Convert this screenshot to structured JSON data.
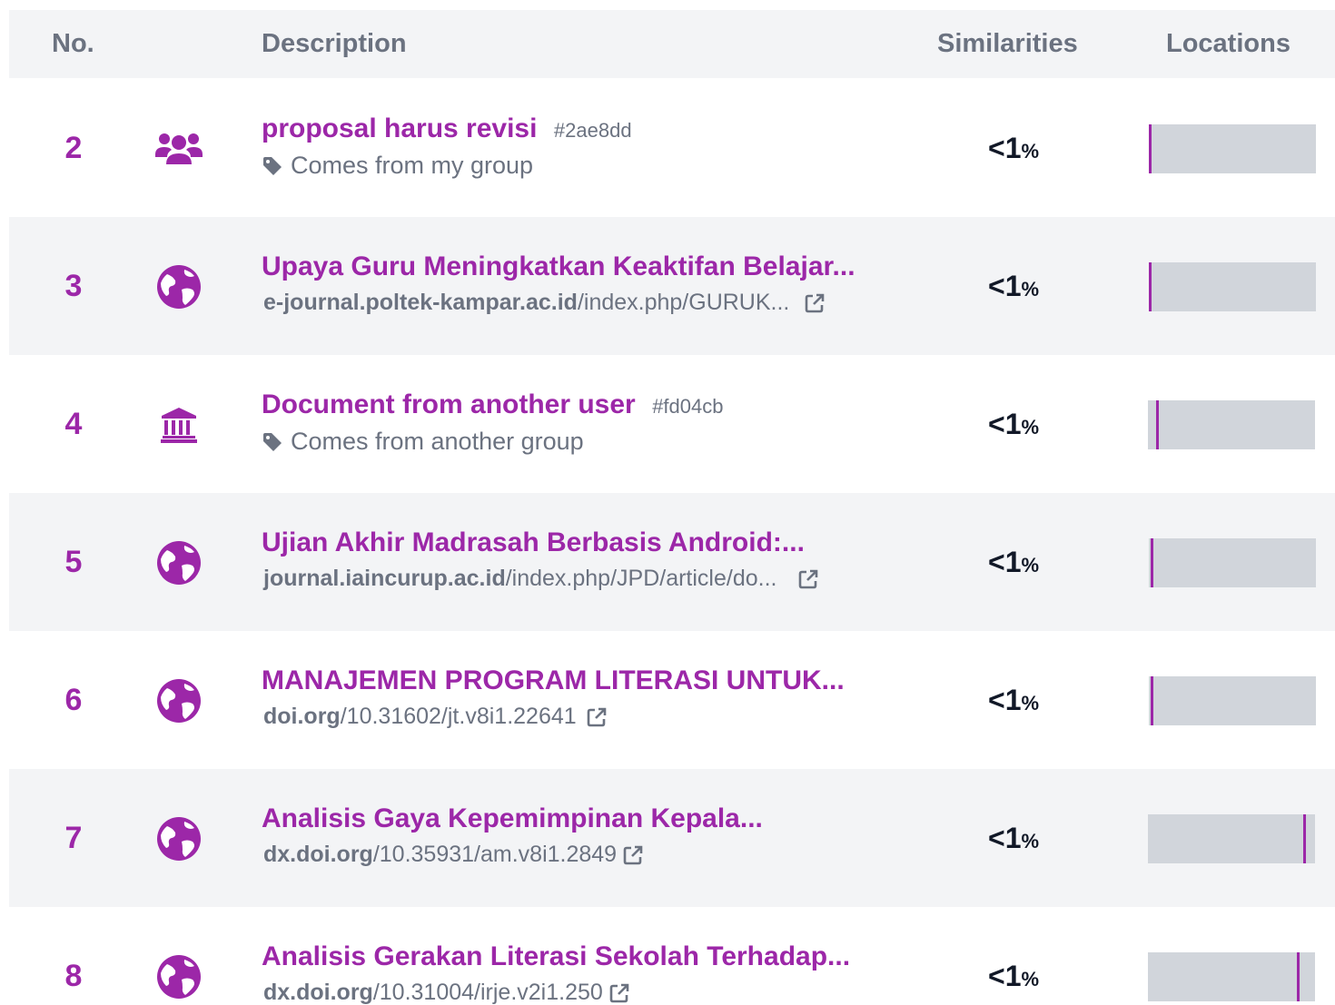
{
  "header": {
    "no": "No.",
    "description": "Description",
    "similarities": "Similarities",
    "locations": "Locations"
  },
  "colors": {
    "accent": "#9c27a8",
    "muted": "#6b7280",
    "bar": "#d1d5db",
    "rowAlt": "#f3f4f6"
  },
  "rows": [
    {
      "no": "2",
      "icon": "users-icon",
      "title": "proposal harus revisi",
      "hash": "#2ae8dd",
      "tag": "Comes from my group",
      "similarity": "<1",
      "pct": "%",
      "location_fraction": 0.0
    },
    {
      "no": "3",
      "icon": "globe-icon",
      "title": "Upaya Guru Meningkatkan Keaktifan Belajar...",
      "url_domain": "e-journal.poltek-kampar.ac.id",
      "url_path": "/index.php/GURUK...",
      "similarity": "<1",
      "pct": "%",
      "location_fraction": 0.0
    },
    {
      "no": "4",
      "icon": "institution-icon",
      "title": "Document from another user",
      "hash": "#fd04cb",
      "tag": "Comes from another group",
      "similarity": "<1",
      "pct": "%",
      "location_fraction": 0.05
    },
    {
      "no": "5",
      "icon": "globe-icon",
      "title": "Ujian Akhir Madrasah Berbasis Android:...",
      "url_domain": "journal.iaincurup.ac.id",
      "url_path": "/index.php/JPD/article/do...",
      "similarity": "<1",
      "pct": "%",
      "location_fraction": 0.01
    },
    {
      "no": "6",
      "icon": "globe-icon",
      "title": "MANAJEMEN PROGRAM LITERASI UNTUK...",
      "url_domain": "doi.org",
      "url_path": "/10.31602/jt.v8i1.22641",
      "similarity": "<1",
      "pct": "%",
      "location_fraction": 0.01
    },
    {
      "no": "7",
      "icon": "globe-icon",
      "title": "Analisis Gaya Kepemimpinan Kepala...",
      "url_domain": "dx.doi.org",
      "url_path": "/10.35931/am.v8i1.2849",
      "similarity": "<1",
      "pct": "%",
      "location_fraction": 0.93
    },
    {
      "no": "8",
      "icon": "globe-icon",
      "title": "Analisis Gerakan Literasi Sekolah Terhadap...",
      "url_domain": "dx.doi.org",
      "url_path": "/10.31004/irje.v2i1.250",
      "similarity": "<1",
      "pct": "%",
      "location_fraction": 0.89
    }
  ]
}
